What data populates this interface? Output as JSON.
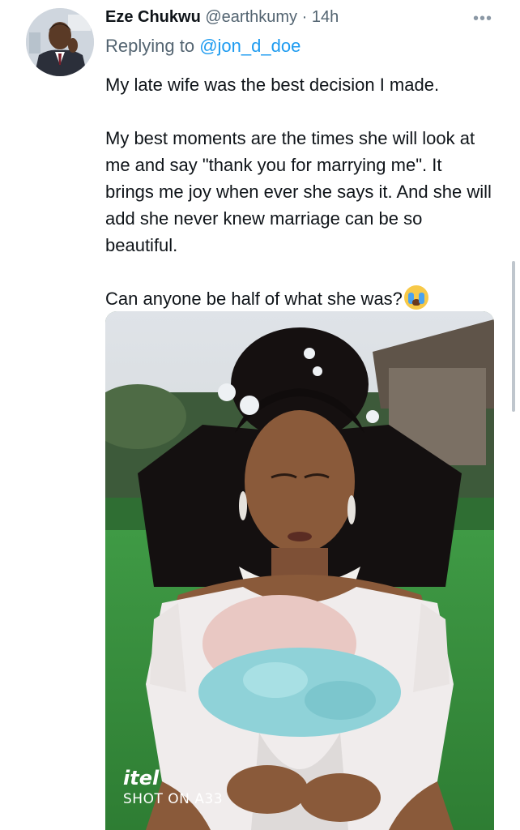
{
  "tweet": {
    "author_name": "Eze Chukwu",
    "handle": "@earthkumy",
    "separator": "·",
    "time": "14h",
    "more_icon": "more-horizontal-icon",
    "replying_prefix": "Replying to",
    "replying_to": "@jon_d_doe",
    "paragraphs": [
      "My late wife was the best decision I made.",
      "My best moments are the times she will look at me and say \"thank you for marrying me\". It brings me joy when ever she says it. And she will add she never knew marriage can be so beautiful.",
      "Can anyone be half of what she was?"
    ],
    "emoji": "loudly-crying-face-emoji"
  },
  "photo": {
    "watermark_brand": "itel",
    "watermark_model": "SHOT ON A33"
  },
  "colors": {
    "link": "#1d9bf0",
    "secondary_text": "#536471",
    "primary_text": "#0f1419"
  }
}
